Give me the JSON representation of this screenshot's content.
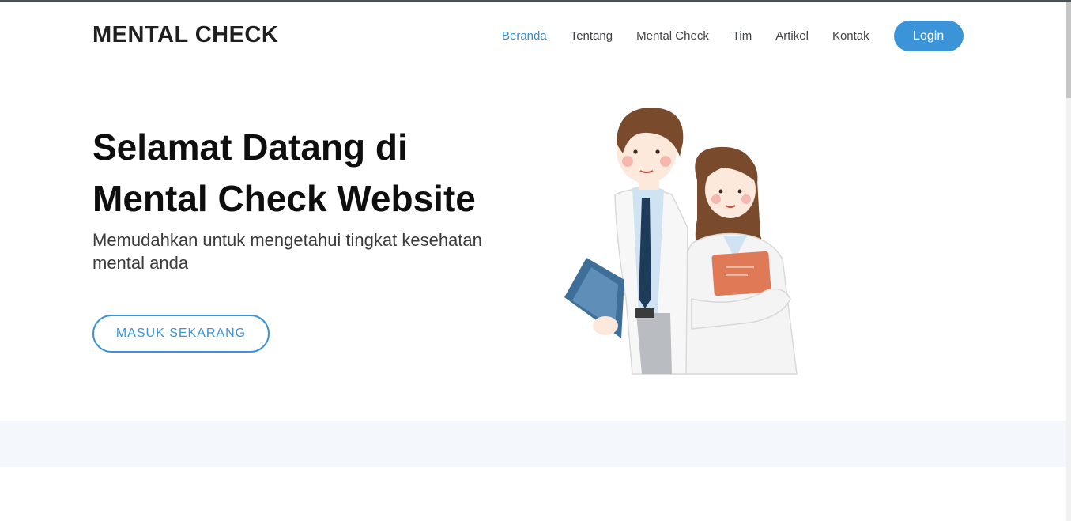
{
  "brand": "MENTAL CHECK",
  "nav": {
    "items": [
      {
        "label": "Beranda",
        "active": true
      },
      {
        "label": "Tentang",
        "active": false
      },
      {
        "label": "Mental Check",
        "active": false
      },
      {
        "label": "Tim",
        "active": false
      },
      {
        "label": "Artikel",
        "active": false
      },
      {
        "label": "Kontak",
        "active": false
      }
    ],
    "login_label": "Login"
  },
  "hero": {
    "title_line1": "Selamat Datang di",
    "title_line2": "Mental Check Website",
    "subtitle": "Memudahkan untuk mengetahui tingkat kesehatan mental anda",
    "cta_label": "MASUK SEKARANG"
  },
  "illustration": {
    "icon": "doctors-illustration"
  },
  "colors": {
    "accent": "#3b93d8",
    "active_link": "#3b8bc8",
    "band_bg": "#f4f8fc",
    "heading": "#0e0e0e"
  }
}
